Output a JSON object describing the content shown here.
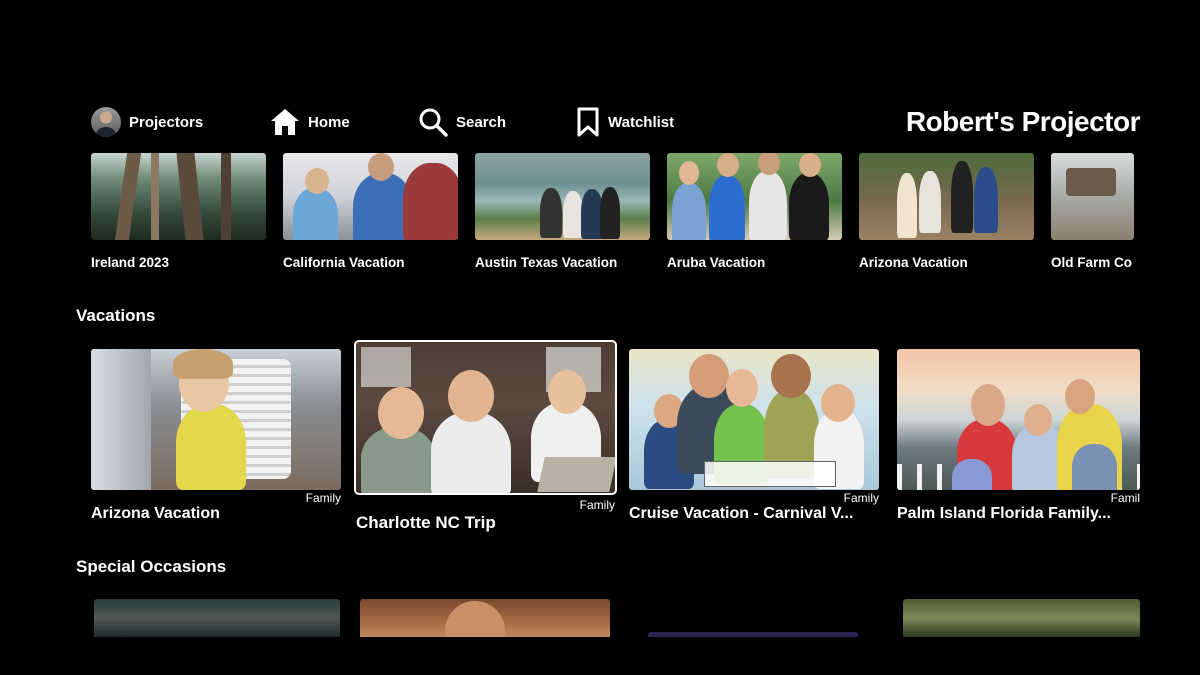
{
  "nav": {
    "items": [
      {
        "label": "Projectors",
        "icon": "user-avatar"
      },
      {
        "label": "Home",
        "icon": "home-icon"
      },
      {
        "label": "Search",
        "icon": "search-icon"
      },
      {
        "label": "Watchlist",
        "icon": "bookmark-icon"
      }
    ],
    "brand": "Robert's Projector"
  },
  "top_row": [
    {
      "label": "Ireland 2023"
    },
    {
      "label": "California Vacation"
    },
    {
      "label": "Austin Texas Vacation"
    },
    {
      "label": "Aruba Vacation"
    },
    {
      "label": "Arizona Vacation"
    },
    {
      "label": "Old Farm Co"
    }
  ],
  "sections": [
    {
      "title": "Vacations",
      "items": [
        {
          "title": "Arizona Vacation",
          "tag": "Family"
        },
        {
          "title": "Charlotte NC Trip",
          "tag": "Family",
          "selected": true
        },
        {
          "title": "Cruise Vacation - Carnival V...",
          "tag": "Family"
        },
        {
          "title": "Palm Island Florida Family...",
          "tag": "Famil"
        }
      ]
    },
    {
      "title": "Special Occasions"
    }
  ],
  "colors": {
    "background": "#000000",
    "text": "#ffffff",
    "selection": "#ffffff"
  }
}
